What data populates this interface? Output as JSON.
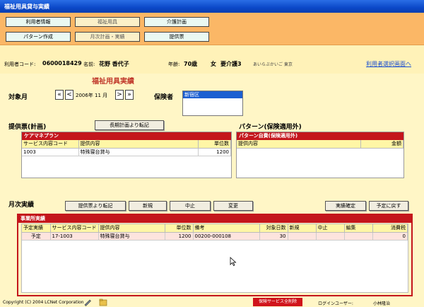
{
  "window": {
    "title": "福祉用具貸与実績"
  },
  "nav": {
    "row1": [
      "利用者情報",
      "福祉用具",
      "介護計画",
      "提供票"
    ],
    "row2": [
      "パターン作成",
      "月次計画・実績",
      "提供票"
    ]
  },
  "user": {
    "code_label": "利用者コード:",
    "code": "0600018429",
    "name_label": "名前:",
    "name": "花野 香代子",
    "age_label": "年齢:",
    "age": "70歳",
    "sex": "女",
    "care_level": "要介護3",
    "kana_address": "あいらぶかいご 東京",
    "select_link": "利用者選択画面へ"
  },
  "page_title": "福祉用具実績",
  "period": {
    "label": "対象月",
    "value": "2006年 11 月",
    "first": "«",
    "prev": "<",
    "next": ">",
    "last": "»"
  },
  "insurer": {
    "label": "保険者",
    "selected": "新宿区"
  },
  "plan_section": {
    "title": "提供票(計画)",
    "copy_button": "長期計画より転記",
    "panel_title": "ケアマネプラン",
    "headers": [
      "サービス内容コード",
      "提供内容",
      "単位数"
    ],
    "rows": [
      [
        "1003",
        "特殊寝台貸与",
        "1200"
      ]
    ]
  },
  "pattern_section": {
    "title": "パターン(保険適用外)",
    "panel_title": "パターン自費(保険適用外)",
    "headers": [
      "提供内容",
      "金額"
    ]
  },
  "monthly": {
    "title": "月次実績",
    "buttons": [
      "提供票より転記",
      "新規",
      "中止",
      "変更"
    ],
    "confirm": "実績確定",
    "back": "予定に戻す",
    "panel_title": "事業所実績",
    "headers": [
      "予定実績",
      "サービス内容コード",
      "提供内容",
      "単位数",
      "備考",
      "対象日数",
      "新規",
      "中止",
      "編集",
      "消費税"
    ],
    "rows": [
      [
        "予定",
        "17-1003",
        "特殊寝台貸与",
        "1200",
        "00200-000108",
        "30",
        "",
        "",
        "",
        "0"
      ]
    ]
  },
  "footer": {
    "copyright": "Copyright (C) 2004 LCNet Corporation",
    "delete_all": "保険サービス全削除",
    "login_label": "ログインユーザー:",
    "login_user": "小林隆治"
  }
}
